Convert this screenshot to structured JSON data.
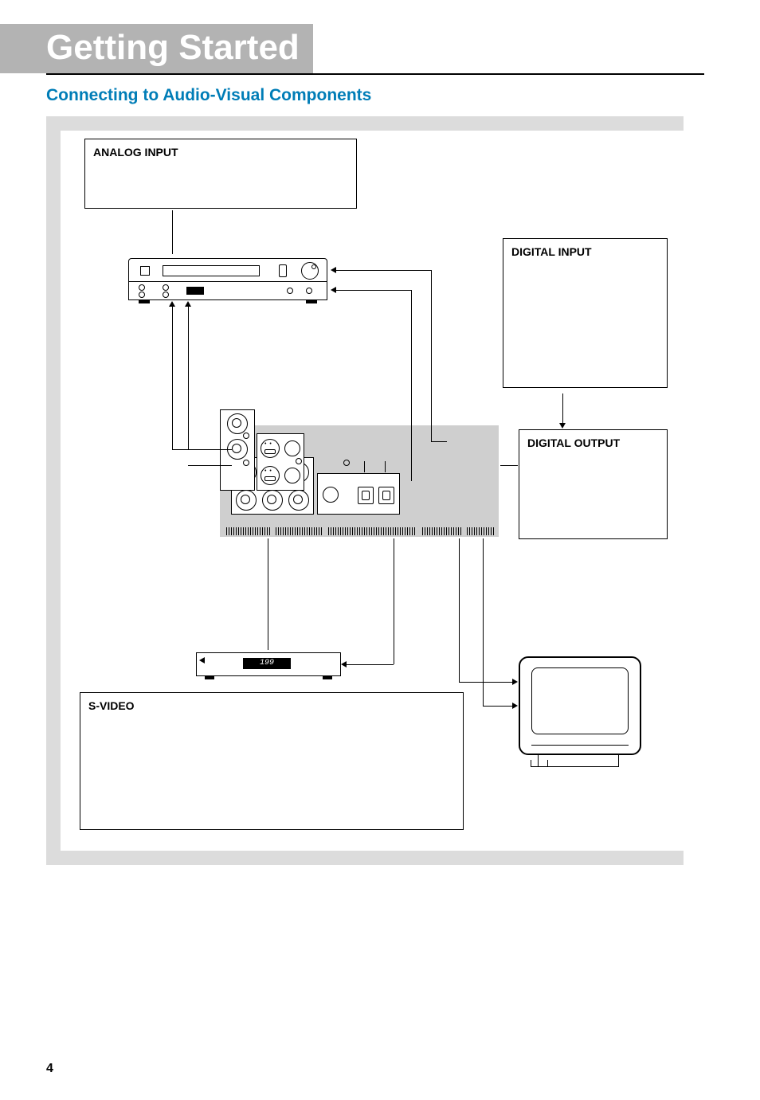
{
  "title": "Getting Started",
  "subheading": "Connecting to Audio-Visual Components",
  "labels": {
    "analog_input": "ANALOG INPUT",
    "digital_input": "DIGITAL INPUT",
    "digital_output": "DIGITAL OUTPUT",
    "svideo": "S-VIDEO"
  },
  "tuner_display": "199",
  "page_number": "4"
}
